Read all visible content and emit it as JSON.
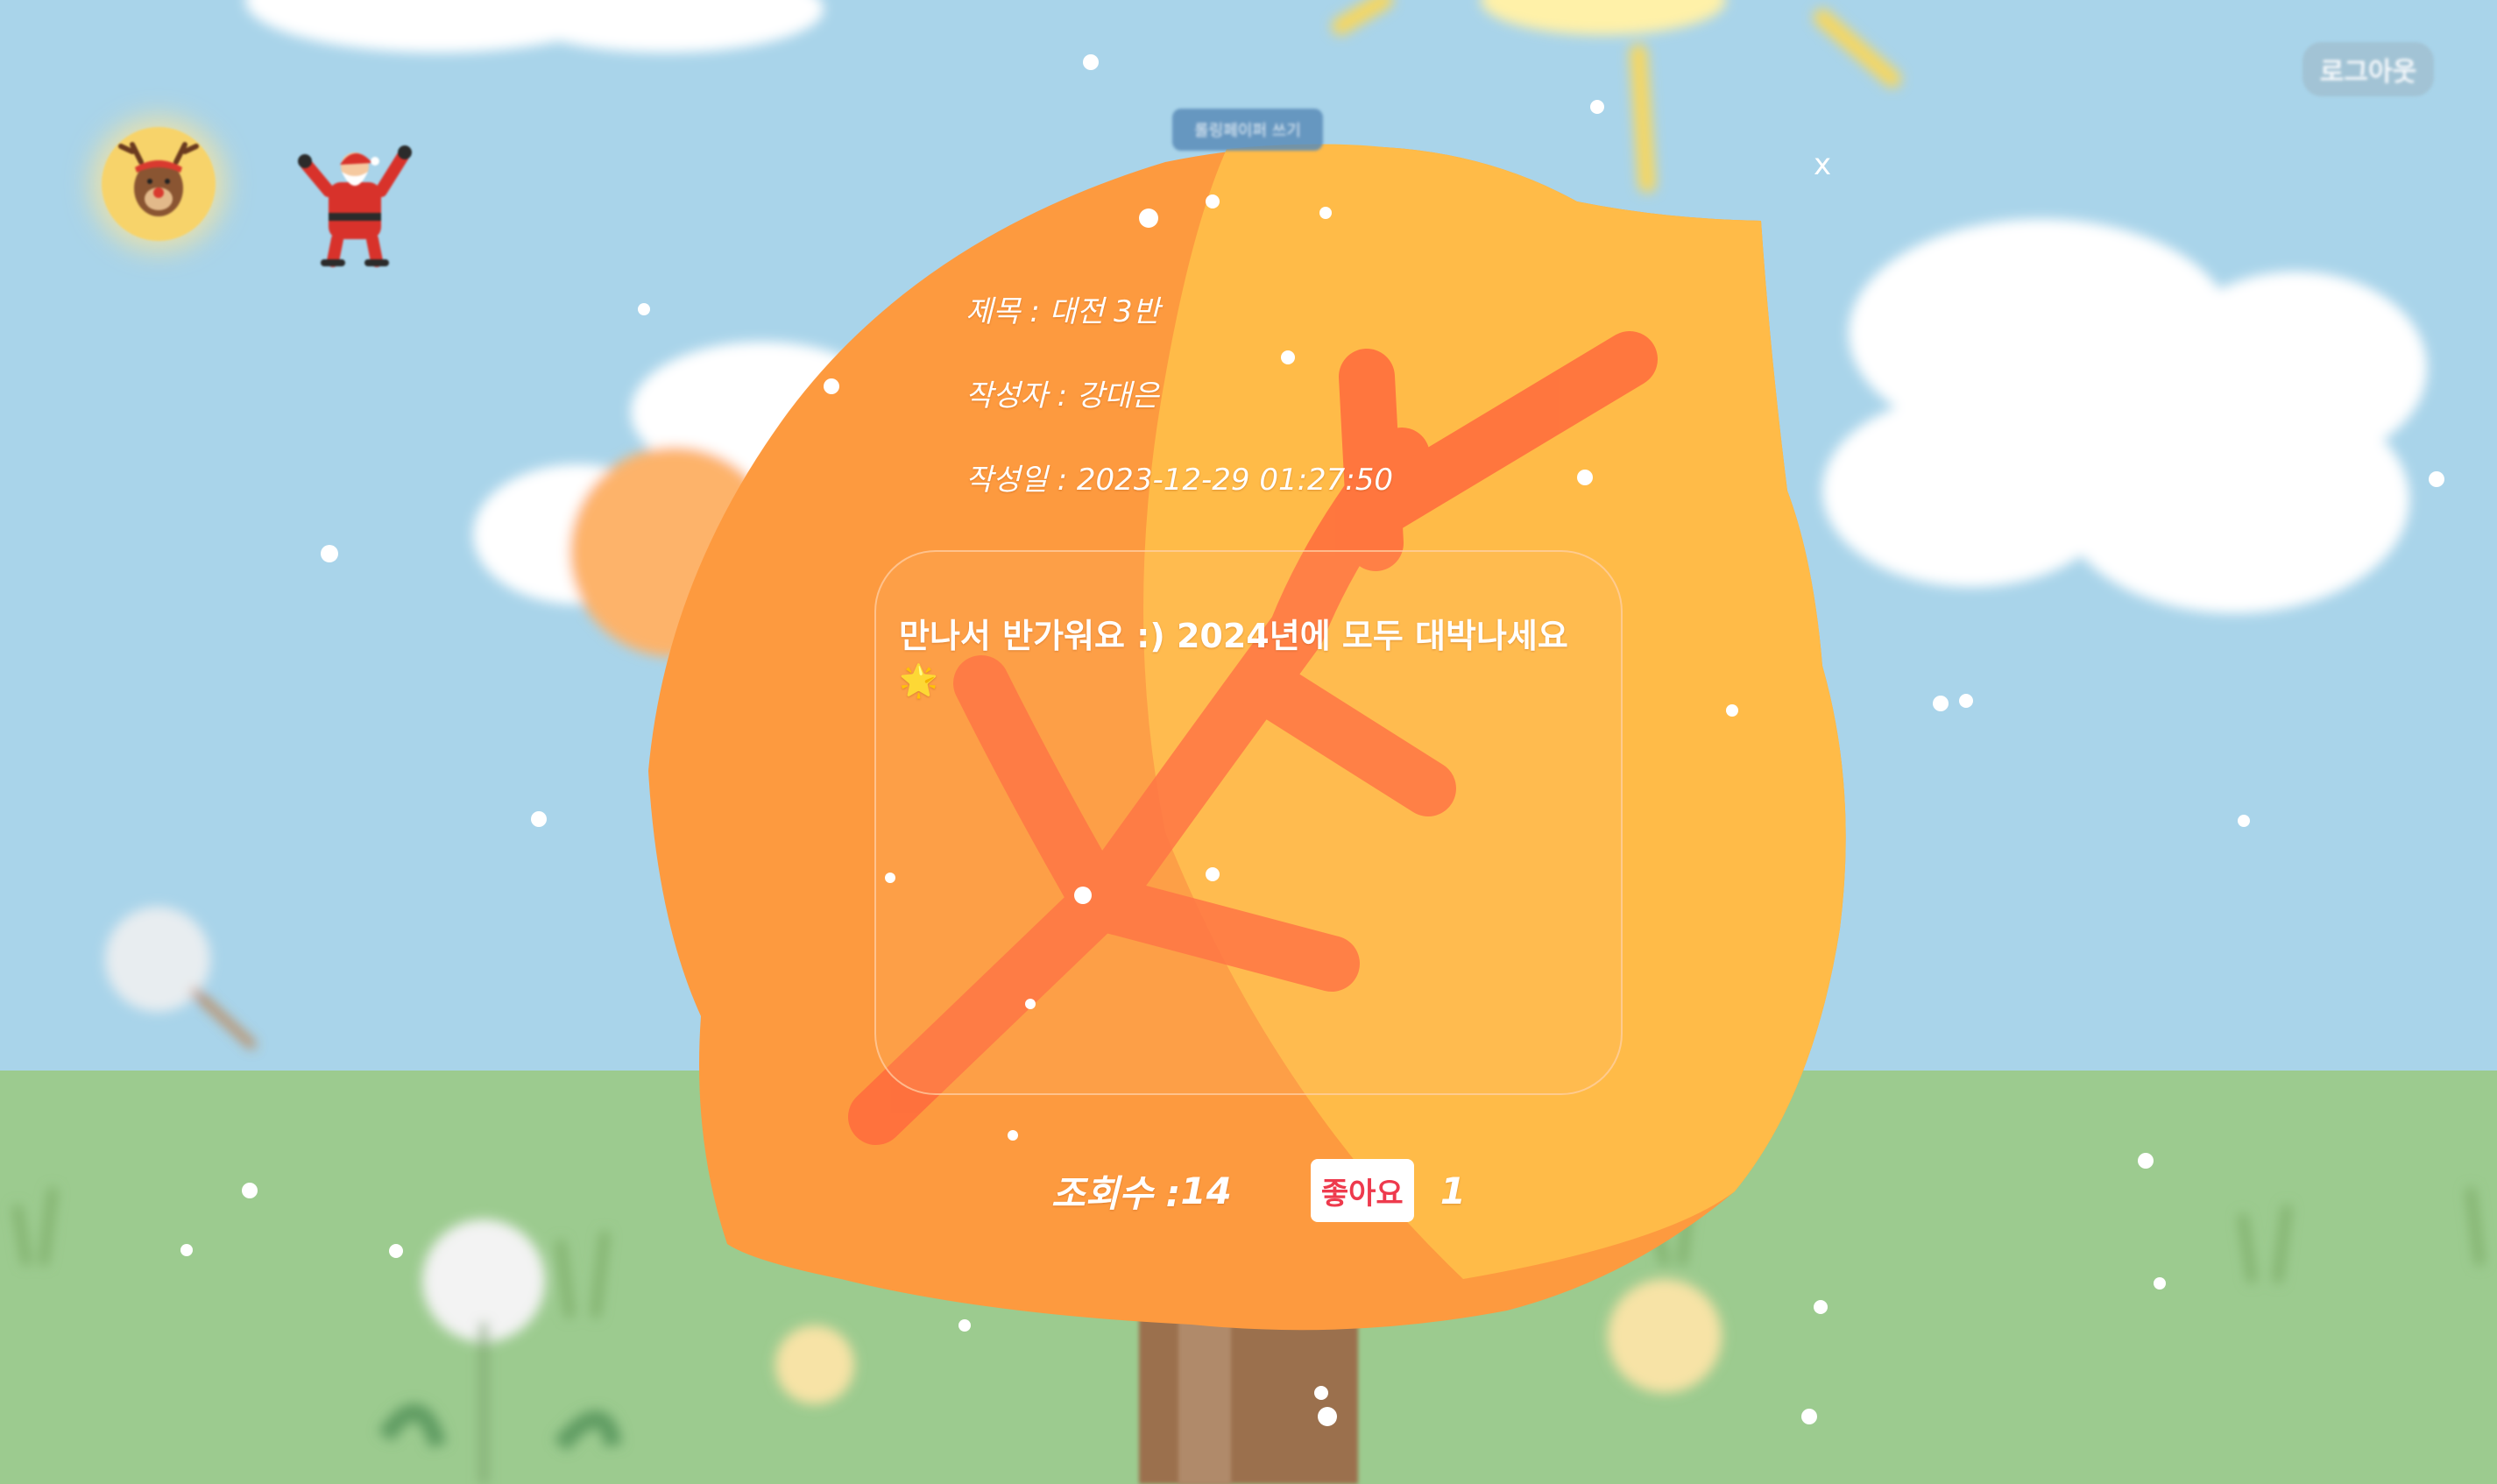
{
  "header": {
    "logout_label": "로그아웃",
    "write_tab_label": "롤링페이퍼 쓰기"
  },
  "modal": {
    "close_label": "x",
    "title_label": "제목 : ",
    "title_value": "대전 3반",
    "author_label": "작성자 : ",
    "author_value": "강대은",
    "date_label": "작성일 : ",
    "date_value": "2023-12-29 01:27:50",
    "content": "만나서 반가워요 :) 2024년에 모두 대박나세요",
    "content_emoji": "🌟",
    "views_label": "조회수 : ",
    "views_value": "14",
    "like_label": "좋아요",
    "like_count": "1"
  },
  "colors": {
    "sky": "#a9d4ea",
    "grass": "#9ccb8f",
    "leaf_orange": "#fd9a3f",
    "leaf_yellow": "#ffbb48",
    "branch": "#ff6b3d",
    "trunk": "#9b6f4e",
    "like_text": "#ee3a4d"
  },
  "icons": {
    "close": "close-icon",
    "reindeer": "reindeer-avatar-icon",
    "santa": "santa-icon"
  }
}
